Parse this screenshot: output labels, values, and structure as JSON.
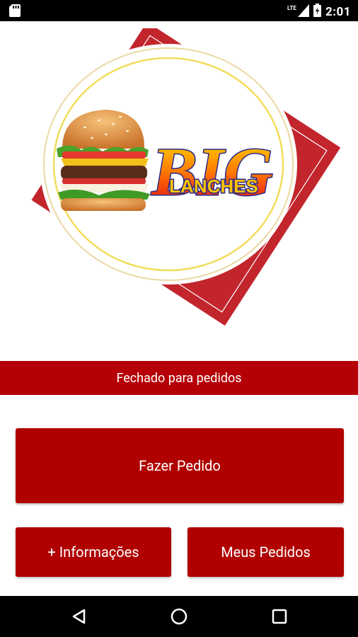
{
  "status_bar": {
    "time": "2:01",
    "network": "LTE",
    "icons": [
      "sd-card-icon",
      "signal-icon",
      "battery-icon"
    ]
  },
  "logo": {
    "brand_line1": "BIG",
    "brand_line2": "LANCHES"
  },
  "store_status": "Fechado para pedidos",
  "buttons": {
    "order": "Fazer Pedido",
    "info": "+ Informações",
    "my_orders": "Meus Pedidos"
  },
  "nav": {
    "icons": [
      "back-icon",
      "home-icon",
      "recents-icon"
    ]
  },
  "colors": {
    "accent": "#b00000",
    "banner": "#b50007",
    "system_bars": "#000000"
  }
}
